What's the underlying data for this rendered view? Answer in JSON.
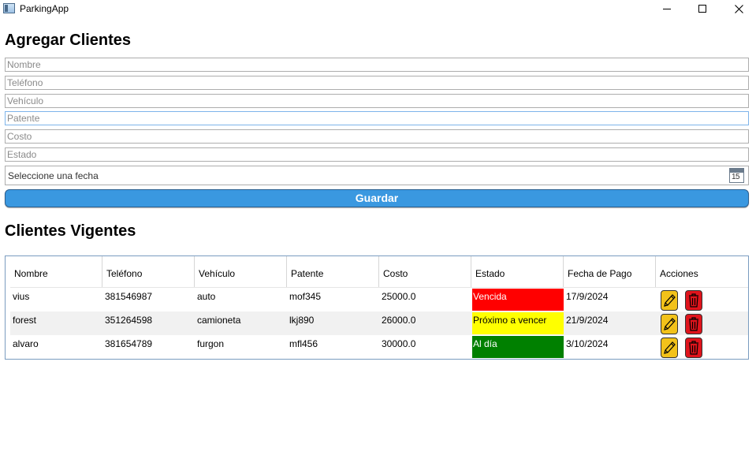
{
  "window": {
    "title": "ParkingApp",
    "icons": {
      "app": "app-window-icon",
      "minimize": "minimize-icon",
      "maximize": "maximize-icon",
      "close": "close-icon"
    }
  },
  "form": {
    "heading": "Agregar Clientes",
    "placeholders": {
      "nombre": "Nombre",
      "telefono": "Teléfono",
      "vehiculo": "Vehículo",
      "patente": "Patente",
      "costo": "Costo",
      "estado": "Estado"
    },
    "values": {
      "nombre": "",
      "telefono": "",
      "vehiculo": "",
      "patente": "",
      "costo": "",
      "estado": ""
    },
    "date_placeholder": "Seleccione una fecha",
    "calendar_icon_day": "15",
    "save_label": "Guardar"
  },
  "list": {
    "heading": "Clientes Vigentes",
    "columns": [
      "Nombre",
      "Teléfono",
      "Vehículo",
      "Patente",
      "Costo",
      "Estado",
      "Fecha de Pago",
      "Acciones"
    ],
    "rows": [
      {
        "nombre": "vius",
        "telefono": "381546987",
        "vehiculo": "auto",
        "patente": "mof345",
        "costo": "25000.0",
        "estado": "Vencida",
        "fecha": "17/9/2024"
      },
      {
        "nombre": "forest",
        "telefono": "351264598",
        "vehiculo": "camioneta",
        "patente": "lkj890",
        "costo": "26000.0",
        "estado": "Próximo a vencer",
        "fecha": "21/9/2024"
      },
      {
        "nombre": "alvaro",
        "telefono": "381654789",
        "vehiculo": "furgon",
        "patente": "mfl456",
        "costo": "30000.0",
        "estado": "Al día",
        "fecha": "3/10/2024"
      }
    ],
    "estado_colors": {
      "Vencida": "#ff0000",
      "Próximo a vencer": "#ffff00",
      "Al día": "#008000"
    },
    "estado_text_colors": {
      "Vencida": "#ffffff",
      "Próximo a vencer": "#000000",
      "Al día": "#ffffff"
    },
    "action_icons": [
      "pencil-icon",
      "trash-icon"
    ]
  },
  "colors": {
    "accent": "#3a98e0",
    "edit": "#f2c21a",
    "delete": "#e0141c"
  }
}
